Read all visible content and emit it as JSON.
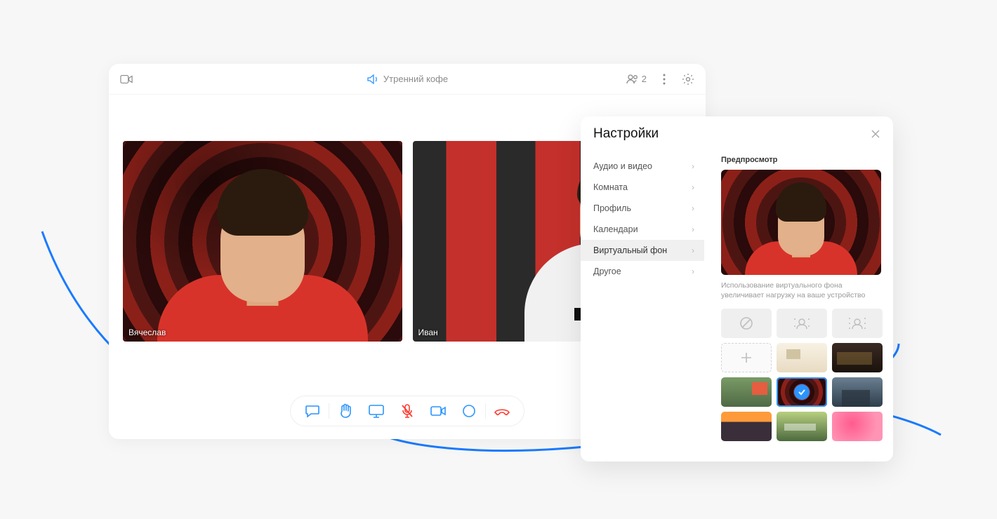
{
  "call": {
    "title": "Утренний кофе",
    "participant_count": "2",
    "tiles": [
      {
        "name": "Вячеслав"
      },
      {
        "name": "Иван"
      }
    ]
  },
  "toolbar": {
    "chat": "chat",
    "raise_hand": "raise-hand",
    "share_screen": "share-screen",
    "mic": "microphone-muted",
    "camera": "camera",
    "record": "record",
    "hangup": "hang-up"
  },
  "settings": {
    "title": "Настройки",
    "items": [
      {
        "label": "Аудио и видео",
        "active": false
      },
      {
        "label": "Комната",
        "active": false
      },
      {
        "label": "Профиль",
        "active": false
      },
      {
        "label": "Календари",
        "active": false
      },
      {
        "label": "Виртуальный фон",
        "active": true
      },
      {
        "label": "Другое",
        "active": false
      }
    ],
    "preview_label": "Предпросмотр",
    "note": "Использование виртуального фона увеличивает нагрузку на ваше устройство",
    "bg_options": [
      {
        "kind": "none"
      },
      {
        "kind": "blur-light"
      },
      {
        "kind": "blur-strong"
      },
      {
        "kind": "add"
      },
      {
        "kind": "img",
        "id": "interior-light"
      },
      {
        "kind": "img",
        "id": "interior-dark"
      },
      {
        "kind": "img",
        "id": "nature-green"
      },
      {
        "kind": "img",
        "id": "carpet",
        "selected": true
      },
      {
        "kind": "img",
        "id": "city-skyline"
      },
      {
        "kind": "img",
        "id": "sunset"
      },
      {
        "kind": "img",
        "id": "stadium"
      },
      {
        "kind": "img",
        "id": "pink-clouds"
      }
    ]
  }
}
